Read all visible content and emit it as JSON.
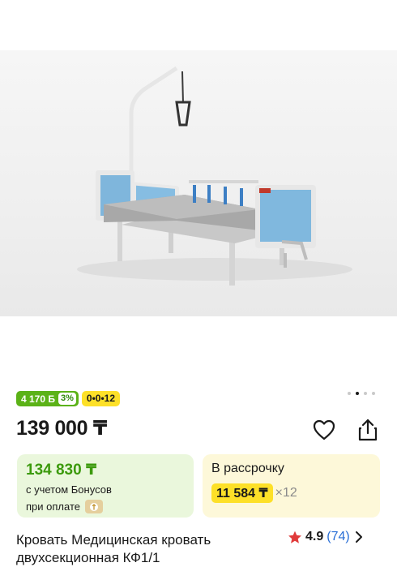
{
  "gallery": {
    "product_image": "product-photo-medical-bed",
    "page_indicator_total": 4,
    "page_indicator_active": 2
  },
  "badges": {
    "bonus_amount": "4 170 Б",
    "bonus_percent": "3%",
    "installment": "0•0•12"
  },
  "price": {
    "main": "139 000 ₸"
  },
  "actions": {
    "favorite_icon": "heart-icon",
    "share_icon": "share-icon"
  },
  "bonus_card": {
    "amount": "134 830 ₸",
    "line1": "с учетом Бонусов",
    "line2": "при оплате",
    "wallet_icon": "wallet-icon"
  },
  "installment_card": {
    "title": "В рассрочку",
    "monthly": "11 584 ₸",
    "multiplier": "×12"
  },
  "product": {
    "title": "Кровать Медицинская кровать двухсекционная КФ1/1",
    "rating": "4.9",
    "reviews": "(74)"
  },
  "colors": {
    "bonus_green": "#5bb217",
    "installment_yellow": "#fde028",
    "link_blue": "#2a6fd6",
    "star_red": "#e03a3a"
  }
}
